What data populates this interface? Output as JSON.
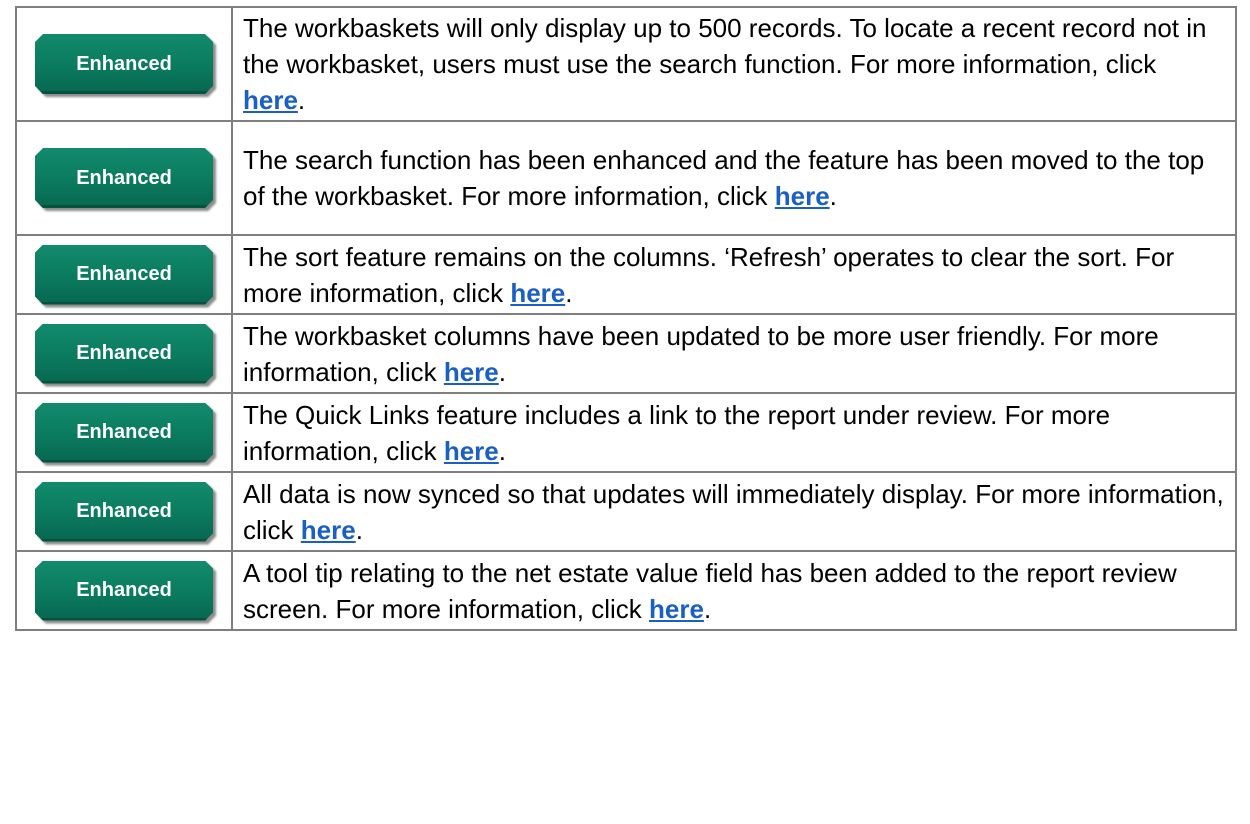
{
  "rows": [
    {
      "badge": "Enhanced",
      "text": "The workbaskets will only display up to 500 records.  To locate a recent record not in the workbasket, users must use the search function.  For more information, click ",
      "link": "here",
      "end": "."
    },
    {
      "badge": "Enhanced",
      "text": "The search function has been enhanced and the feature has been moved to the top of the workbasket.  For more information, click ",
      "link": "here",
      "end": "."
    },
    {
      "badge": "Enhanced",
      "text": "The sort feature remains on the columns.  ‘Refresh’ operates to clear the sort. For more information, click ",
      "link": "here",
      "end": "."
    },
    {
      "badge": "Enhanced",
      "text": "The workbasket columns have been updated to be more user friendly. For more information, click ",
      "link": "here",
      "end": "."
    },
    {
      "badge": "Enhanced",
      "text": "The Quick Links feature includes a link to the report under review. For more information, click ",
      "link": "here",
      "end": "."
    },
    {
      "badge": "Enhanced",
      "text": "All data is now synced so that updates will immediately display.  For more information, click ",
      "link": "here",
      "end": "."
    },
    {
      "badge": "Enhanced",
      "text": "A tool tip relating to the net estate value field has been added to the report review screen. For more information, click ",
      "link": "here",
      "end": "."
    }
  ],
  "colors": {
    "badge_green": "#0a7a5e",
    "link_blue": "#1a5fc4"
  }
}
